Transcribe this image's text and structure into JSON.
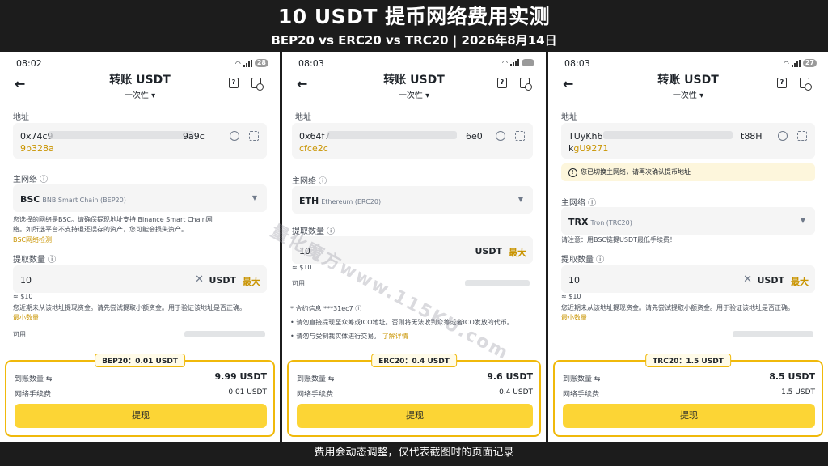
{
  "header": {
    "title": "10 USDT 提币网络费用实测",
    "subtitle": "BEP20 vs ERC20 vs TRC20 | 2026年8月14日"
  },
  "footer": {
    "text": "费用会动态调整，仅代表截图时的页面记录"
  },
  "watermark": "量化魔方www.115KU.com",
  "common": {
    "page_title": "转账 USDT",
    "mode": "一次性",
    "back": "←",
    "address_label": "地址",
    "network_label": "主网络",
    "amount_label": "提取数量",
    "unit": "USDT",
    "max": "最大",
    "approx": "≈ $10",
    "available": "可用",
    "receive_label": "到账数量",
    "fee_label": "网络手续费",
    "withdraw": "提现",
    "swap_glyph": "⇆"
  },
  "panels": [
    {
      "time": "08:02",
      "battery": "28",
      "address_start": "0x74c9",
      "address_end": "9a9c",
      "address_line2": "9b328a",
      "network_code": "BSC",
      "network_name": "BNB Smart Chain (BEP20)",
      "note": "您选择的网络是BSC。请确保提现地址支持 Binance Smart Chain网络。如所选平台不支持退还误存的资产，您可能会损失资产。",
      "note_link": "BSC网络检测",
      "amount": "10",
      "recent_note": "您近期未从该地址提现资金。请先尝试提取小额资金。用于验证该地址是否正确。",
      "min_link": "最小数量",
      "tag": "BEP20：0.01 USDT",
      "receive": "9.99 USDT",
      "fee": "0.01 USDT"
    },
    {
      "time": "08:03",
      "battery": "",
      "address_start": "0x64f7",
      "address_end": "6e0",
      "address_line2": "cfce2c",
      "network_code": "ETH",
      "network_name": "Ethereum (ERC20)",
      "amount": "10",
      "contract_info": "* 合约信息 ***31ec7",
      "bullet1": "• 请勿直接提现至众筹或ICO地址。否则将无法收到众筹或者ICO发放的代币。",
      "bullet2": "• 请勿与受制裁实体进行交易。",
      "learn_more": "了解详情",
      "tag": "ERC20：0.4 USDT",
      "receive": "9.6 USDT",
      "fee": "0.4 USDT"
    },
    {
      "time": "08:03",
      "battery": "27",
      "address_start": "TUyKh6",
      "address_end": "t88H",
      "address_line2": "kgU9271",
      "address_line2_prefix": "k",
      "address_line2_rest": "gU9271",
      "switch_warning": "您已切换主网络，请再次确认提币地址",
      "network_code": "TRX",
      "network_name": "Tron (TRC20)",
      "note": "请注意：用BSC链提USDT最低手续费！",
      "amount": "10",
      "recent_note": "您近期未从该地址提现资金。请先尝试提取小额资金。用于验证该地址是否正确。",
      "min_link": "最小数量",
      "tag": "TRC20：1.5 USDT",
      "receive": "8.5 USDT",
      "fee": "1.5 USDT"
    }
  ]
}
